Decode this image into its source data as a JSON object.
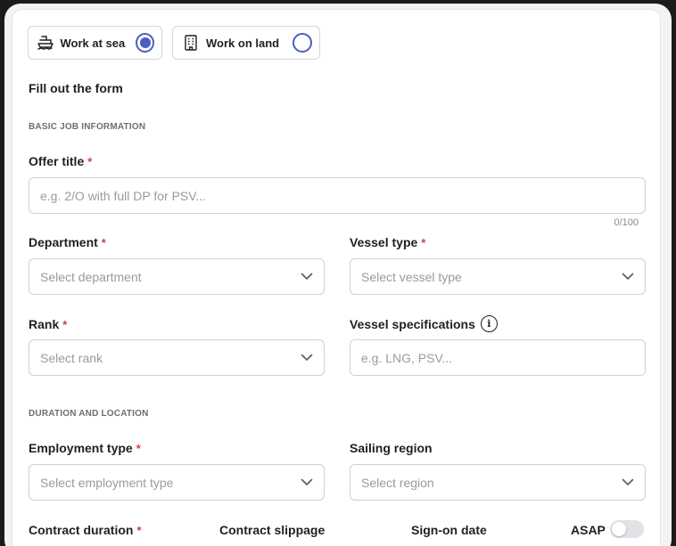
{
  "mode": {
    "sea": {
      "label": "Work at sea",
      "selected": true
    },
    "land": {
      "label": "Work on land",
      "selected": false
    }
  },
  "form": {
    "heading": "Fill out the form",
    "sections": {
      "basic": "BASIC JOB INFORMATION",
      "duration": "DURATION AND LOCATION"
    },
    "offer_title": {
      "label": "Offer title",
      "required_mark": "*",
      "placeholder": "e.g. 2/O with full DP for PSV...",
      "counter": "0/100"
    },
    "department": {
      "label": "Department",
      "required_mark": "*",
      "placeholder": "Select department"
    },
    "vessel_type": {
      "label": "Vessel type",
      "required_mark": "*",
      "placeholder": "Select vessel type"
    },
    "rank": {
      "label": "Rank",
      "required_mark": "*",
      "placeholder": "Select rank"
    },
    "vessel_specs": {
      "label": "Vessel specifications",
      "placeholder": "e.g. LNG, PSV..."
    },
    "employment_type": {
      "label": "Employment type",
      "required_mark": "*",
      "placeholder": "Select employment type"
    },
    "sailing_region": {
      "label": "Sailing region",
      "placeholder": "Select region"
    },
    "contract_duration": {
      "label": "Contract duration",
      "required_mark": "*"
    },
    "contract_slippage": {
      "label": "Contract slippage"
    },
    "sign_on_date": {
      "label": "Sign-on date"
    },
    "asap": {
      "label": "ASAP",
      "on": false
    }
  },
  "colors": {
    "accent": "#4a5fc1",
    "required": "#d93c3c",
    "border": "#cfcfd6",
    "placeholder": "#9a9aa2"
  },
  "icons": {
    "sea": "ship-icon",
    "land": "building-icon",
    "dropdown": "chevron-down-icon",
    "info": "info-icon"
  }
}
